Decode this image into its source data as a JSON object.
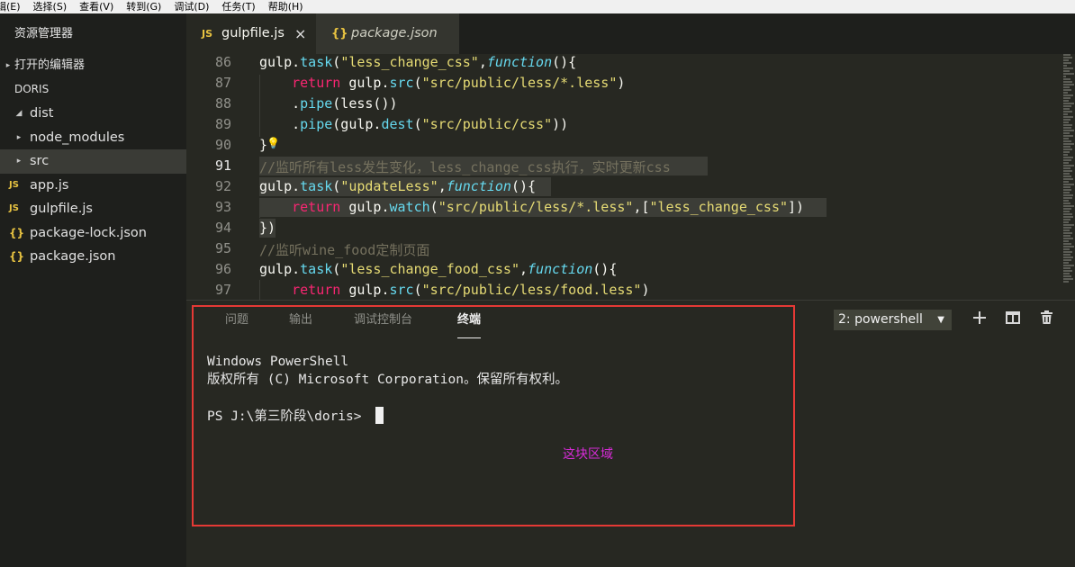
{
  "menu": [
    "辑(E)",
    "选择(S)",
    "查看(V)",
    "转到(G)",
    "调试(D)",
    "任务(T)",
    "帮助(H)"
  ],
  "sidebar": {
    "title": "资源管理器",
    "open_editors": "打开的编辑器",
    "project": "DORIS",
    "items": [
      {
        "label": "dist",
        "expanded": true
      },
      {
        "label": "node_modules",
        "expanded": false
      },
      {
        "label": "src",
        "expanded": false
      },
      {
        "label": "app.js",
        "type": "js"
      },
      {
        "label": "gulpfile.js",
        "type": "js"
      },
      {
        "label": "package-lock.json",
        "type": "json"
      },
      {
        "label": "package.json",
        "type": "json"
      }
    ],
    "icons": {
      "js": "JS",
      "json": "{}",
      "expanded": "◢",
      "collapsed": "▸"
    }
  },
  "tabs": [
    {
      "label": "gulpfile.js",
      "icon": "JS",
      "close": "×"
    },
    {
      "label": "package.json",
      "icon": "{}"
    }
  ],
  "editor": {
    "line_numbers": [
      "86",
      "87",
      "88",
      "89",
      "90",
      "91",
      "92",
      "93",
      "94",
      "95",
      "96",
      "97"
    ],
    "lines": [
      [
        [
          "obj",
          "gulp."
        ],
        [
          "meth",
          "task"
        ],
        [
          "obj",
          "("
        ],
        [
          "str",
          "\"less_change_css\""
        ],
        [
          "obj",
          ","
        ],
        [
          "fn",
          "function"
        ],
        [
          "obj",
          "(){"
        ]
      ],
      [
        [
          "obj",
          "    "
        ],
        [
          "kw",
          "return"
        ],
        [
          "obj",
          " gulp."
        ],
        [
          "meth",
          "src"
        ],
        [
          "obj",
          "("
        ],
        [
          "str",
          "\"src/public/less/*.less\""
        ],
        [
          "obj",
          ")"
        ]
      ],
      [
        [
          "obj",
          "    ."
        ],
        [
          "meth",
          "pipe"
        ],
        [
          "obj",
          "(less())"
        ]
      ],
      [
        [
          "obj",
          "    ."
        ],
        [
          "meth",
          "pipe"
        ],
        [
          "obj",
          "(gulp."
        ],
        [
          "meth",
          "dest"
        ],
        [
          "obj",
          "("
        ],
        [
          "str",
          "\"src/public/css\""
        ],
        [
          "obj",
          "))"
        ]
      ],
      [
        [
          "obj",
          "}"
        ]
      ],
      [
        [
          "cm",
          "//监听所有less发生变化，less_change_css执行，实时更新css"
        ]
      ],
      [
        [
          "obj",
          "gulp."
        ],
        [
          "meth",
          "task"
        ],
        [
          "obj",
          "("
        ],
        [
          "str",
          "\"updateLess\""
        ],
        [
          "obj",
          ","
        ],
        [
          "fn",
          "function"
        ],
        [
          "obj",
          "(){"
        ]
      ],
      [
        [
          "obj",
          "    "
        ],
        [
          "kw",
          "return"
        ],
        [
          "obj",
          " gulp."
        ],
        [
          "meth",
          "watch"
        ],
        [
          "obj",
          "("
        ],
        [
          "str",
          "\"src/public/less/*.less\""
        ],
        [
          "obj",
          ",["
        ],
        [
          "str",
          "\"less_change_css\""
        ],
        [
          "obj",
          "])"
        ]
      ],
      [
        [
          "obj",
          "})"
        ]
      ],
      [
        [
          "cm",
          "//监听wine_food定制页面"
        ]
      ],
      [
        [
          "obj",
          "gulp."
        ],
        [
          "meth",
          "task"
        ],
        [
          "obj",
          "("
        ],
        [
          "str",
          "\"less_change_food_css\""
        ],
        [
          "obj",
          ","
        ],
        [
          "fn",
          "function"
        ],
        [
          "obj",
          "(){"
        ]
      ],
      [
        [
          "obj",
          "    "
        ],
        [
          "kw",
          "return"
        ],
        [
          "obj",
          " gulp."
        ],
        [
          "meth",
          "src"
        ],
        [
          "obj",
          "("
        ],
        [
          "str",
          "\"src/public/less/food.less\""
        ],
        [
          "obj",
          ")"
        ]
      ]
    ]
  },
  "panel": {
    "tabs": [
      "问题",
      "输出",
      "调试控制台",
      "终端"
    ],
    "active_tab": "终端",
    "shell_select": "2: powershell",
    "shell_dropdown": "▼",
    "buttons": {
      "add": "+",
      "split": "◫",
      "trash": "🗑"
    },
    "terminal_lines": [
      "Windows PowerShell",
      "版权所有 (C) Microsoft Corporation。保留所有权利。",
      "",
      "PS J:\\第三阶段\\doris> "
    ],
    "annotation_label": "这块区域",
    "annotation_color": "#e53935"
  }
}
